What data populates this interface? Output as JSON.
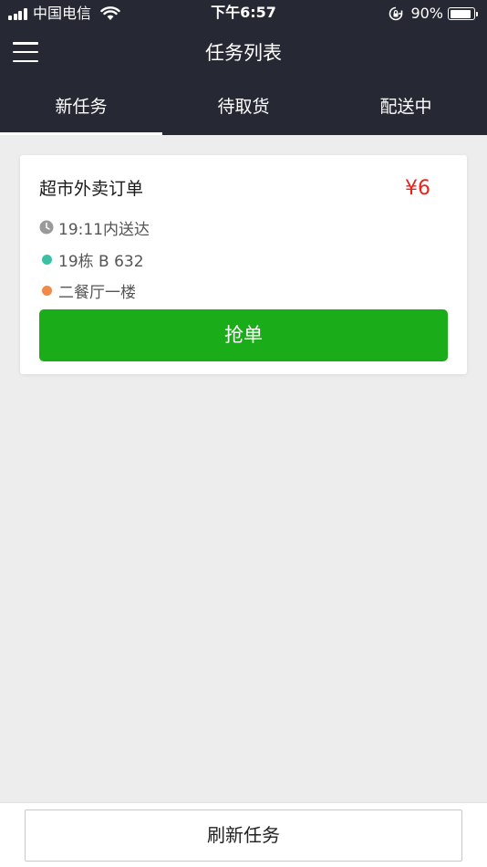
{
  "status_bar": {
    "carrier": "中国电信",
    "time": "下午6:57",
    "battery_percent": "90%",
    "battery_level": 0.9,
    "icons": [
      "signal-icon",
      "wifi-icon",
      "rotation-lock-icon",
      "battery-icon"
    ]
  },
  "nav": {
    "title": "任务列表",
    "menu_icon": "hamburger-menu-icon"
  },
  "tabs": [
    {
      "label": "新任务",
      "active": true
    },
    {
      "label": "待取货",
      "active": false
    },
    {
      "label": "配送中",
      "active": false
    }
  ],
  "task": {
    "title": "超市外卖订单",
    "price": "¥6",
    "deliver_time": "19:11内送达",
    "destination": "19栋 B 632",
    "pickup": "二餐厅一楼",
    "grab_label": "抢单"
  },
  "footer": {
    "refresh_label": "刷新任务"
  },
  "colors": {
    "header_bg": "#262833",
    "page_bg": "#ededed",
    "accent_green": "#1aad19",
    "price_red": "#e8231d",
    "destination_dot": "#3dbfa5",
    "pickup_dot": "#f0894a",
    "clock_gray": "#9a9a9a"
  }
}
